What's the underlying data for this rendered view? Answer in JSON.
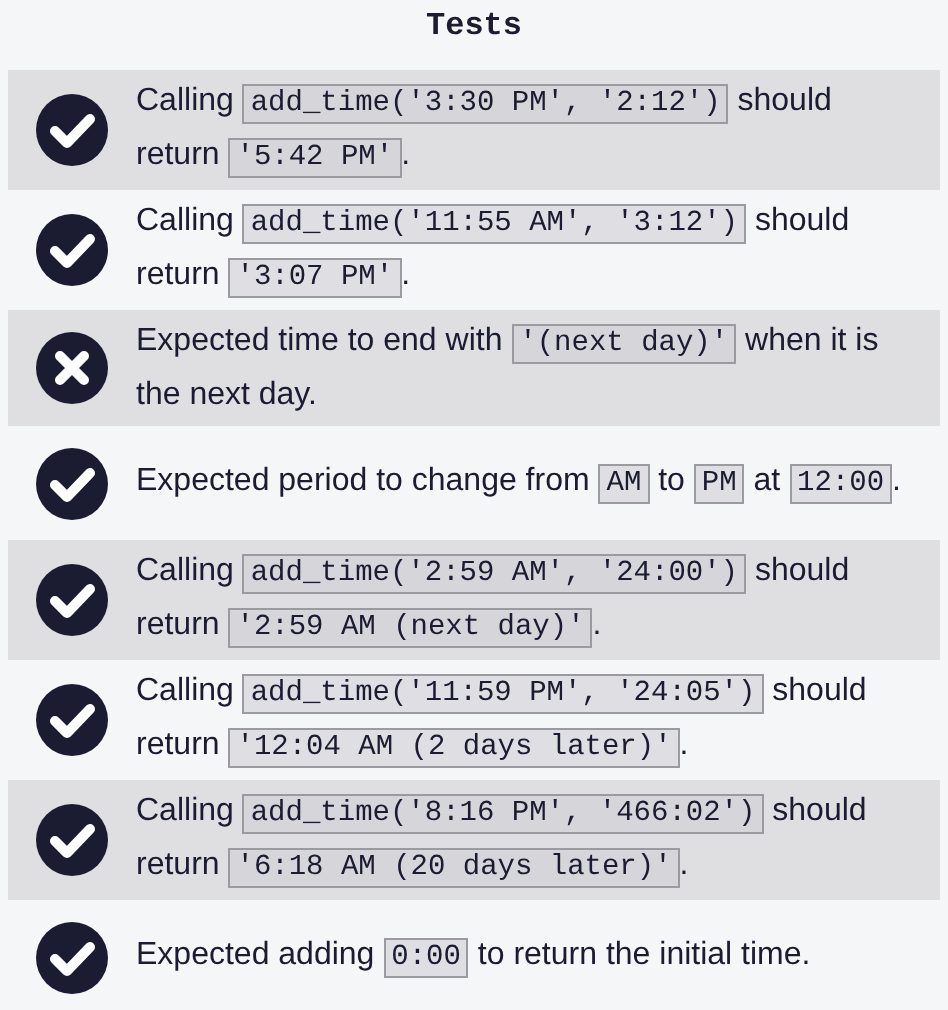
{
  "title": "Tests",
  "tests": [
    {
      "passed": true,
      "parts": [
        {
          "kind": "text",
          "text": "Calling "
        },
        {
          "kind": "code",
          "text": "add_time('3:30 PM', '2:12')"
        },
        {
          "kind": "text",
          "text": " should return "
        },
        {
          "kind": "code",
          "text": "'5:42 PM'"
        },
        {
          "kind": "text",
          "text": "."
        }
      ]
    },
    {
      "passed": true,
      "parts": [
        {
          "kind": "text",
          "text": "Calling "
        },
        {
          "kind": "code",
          "text": "add_time('11:55 AM', '3:12')"
        },
        {
          "kind": "text",
          "text": " should return "
        },
        {
          "kind": "code",
          "text": "'3:07 PM'"
        },
        {
          "kind": "text",
          "text": "."
        }
      ]
    },
    {
      "passed": false,
      "parts": [
        {
          "kind": "text",
          "text": "Expected time to end with "
        },
        {
          "kind": "code",
          "text": "'(next day)'"
        },
        {
          "kind": "text",
          "text": " when it is the next day."
        }
      ]
    },
    {
      "passed": true,
      "parts": [
        {
          "kind": "text",
          "text": "Expected period to change from "
        },
        {
          "kind": "code",
          "text": "AM"
        },
        {
          "kind": "text",
          "text": " to "
        },
        {
          "kind": "code",
          "text": "PM"
        },
        {
          "kind": "text",
          "text": " at "
        },
        {
          "kind": "code",
          "text": "12:00"
        },
        {
          "kind": "text",
          "text": "."
        }
      ]
    },
    {
      "passed": true,
      "parts": [
        {
          "kind": "text",
          "text": "Calling "
        },
        {
          "kind": "code",
          "text": "add_time('2:59 AM', '24:00')"
        },
        {
          "kind": "text",
          "text": " should return "
        },
        {
          "kind": "code",
          "text": "'2:59 AM (next day)'"
        },
        {
          "kind": "text",
          "text": "."
        }
      ]
    },
    {
      "passed": true,
      "parts": [
        {
          "kind": "text",
          "text": "Calling "
        },
        {
          "kind": "code",
          "text": "add_time('11:59 PM', '24:05')"
        },
        {
          "kind": "text",
          "text": " should return "
        },
        {
          "kind": "code",
          "text": "'12:04 AM (2 days later)'"
        },
        {
          "kind": "text",
          "text": "."
        }
      ]
    },
    {
      "passed": true,
      "parts": [
        {
          "kind": "text",
          "text": "Calling "
        },
        {
          "kind": "code",
          "text": "add_time('8:16 PM', '466:02')"
        },
        {
          "kind": "text",
          "text": " should return "
        },
        {
          "kind": "code",
          "text": "'6:18 AM (20 days later)'"
        },
        {
          "kind": "text",
          "text": "."
        }
      ]
    },
    {
      "passed": true,
      "parts": [
        {
          "kind": "text",
          "text": "Expected adding "
        },
        {
          "kind": "code",
          "text": "0:00"
        },
        {
          "kind": "text",
          "text": " to return the initial time."
        }
      ]
    }
  ]
}
